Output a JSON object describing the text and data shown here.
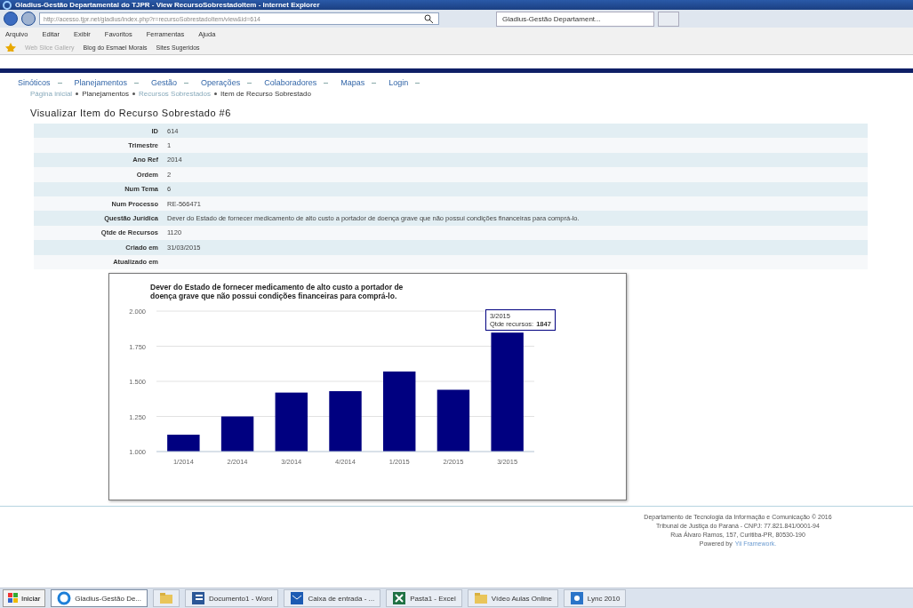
{
  "window": {
    "title": "Gladius-Gestão Departamental do TJPR - View RecursoSobrestadoItem - Internet Explorer"
  },
  "address_bar": {
    "url": "http://acesso.tjpr.net/gladius/index.php?r=recursoSobrestadoItem/view&id=614"
  },
  "browser_tab": {
    "title": "Gladius-Gestão Departament...",
    "selected": true
  },
  "menu_bar": [
    "Arquivo",
    "Editar",
    "Exibir",
    "Favoritos",
    "Ferramentas",
    "Ajuda"
  ],
  "favorites_bar": [
    "Web Slice Gallery",
    "Blog do Esmael Morais",
    "Sites Sugeridos"
  ],
  "nav_menu": [
    "Sinóticos",
    "Planejamentos",
    "Gestão",
    "Operações",
    "Colaboradores",
    "Mapas",
    "Login"
  ],
  "breadcrumbs": [
    {
      "label": "Página inicial",
      "link": true
    },
    {
      "label": "Planejamentos",
      "link": false
    },
    {
      "label": "Recursos Sobrestados",
      "link": true
    },
    {
      "label": "Item de Recurso Sobrestado",
      "link": false
    }
  ],
  "heading": "Visualizar Item do Recurso Sobrestado #6",
  "details": [
    {
      "label": "ID",
      "value": "614"
    },
    {
      "label": "Trimestre",
      "value": "1"
    },
    {
      "label": "Ano Ref",
      "value": "2014"
    },
    {
      "label": "Ordem",
      "value": "2"
    },
    {
      "label": "Num Tema",
      "value": "6"
    },
    {
      "label": "Num Processo",
      "value": "RE-566471"
    },
    {
      "label": "Questão Jurídica",
      "value": "Dever do Estado de fornecer medicamento de alto custo a portador de doença grave que não possui condições financeiras para comprá-lo."
    },
    {
      "label": "Qtde de Recursos",
      "value": "1120"
    },
    {
      "label": "Criado em",
      "value": "31/03/2015"
    },
    {
      "label": "Atualizado em"
    }
  ],
  "chart": {
    "chart_data": {
      "type": "bar",
      "title": "Dever do Estado de fornecer medicamento de alto custo a portador de doença grave que não possui condições financeiras para comprá-lo.",
      "categories": [
        "1/2014",
        "2/2014",
        "3/2014",
        "4/2014",
        "1/2015",
        "2/2015",
        "3/2015"
      ],
      "grid": true,
      "series": [
        {
          "color": "#000080",
          "values": [
            1120,
            1250,
            1420,
            1430,
            1570,
            1440,
            1847
          ]
        }
      ],
      "ylim": [
        1000,
        2000
      ],
      "yticks": [
        {
          "value": 1000,
          "label": "1.000"
        },
        {
          "value": 1250,
          "label": "1.250"
        },
        {
          "value": 1500,
          "label": "1.500"
        },
        {
          "value": 1750,
          "label": "1.750"
        },
        {
          "value": 2000,
          "label": "2.000"
        }
      ]
    },
    "tooltip": {
      "category": "3/2015",
      "label": "Qtde recursos:",
      "value": "1847"
    }
  },
  "footer": {
    "lines": [
      "Departamento de Tecnologia da Informação e Comunicação © 2016",
      "Tribunal de Justiça do Paraná - CNPJ: 77.821.841/0001-94",
      "Rua Álvaro Ramos, 157, Curitiba-PR, 80530-190"
    ],
    "powered_by": "Powered by",
    "framework_link": "Yii Framework."
  },
  "taskbar": {
    "start": "Iniciar",
    "items": [
      {
        "label": "Gladius-Gestão De...",
        "kind": "ie",
        "selected": true
      },
      {
        "kind": "folder",
        "selected": false
      },
      {
        "label": "Documento1 - Word",
        "kind": "word",
        "selected": false
      },
      {
        "label": "Caixa de entrada - ...",
        "kind": "outlook",
        "selected": false
      },
      {
        "label": "Pasta1 - Excel",
        "kind": "excel",
        "selected": false
      },
      {
        "label": "Vídeo Aulas Online",
        "kind": "folder",
        "selected": false
      },
      {
        "label": "Lync 2010",
        "kind": "lync",
        "selected": false
      }
    ]
  }
}
